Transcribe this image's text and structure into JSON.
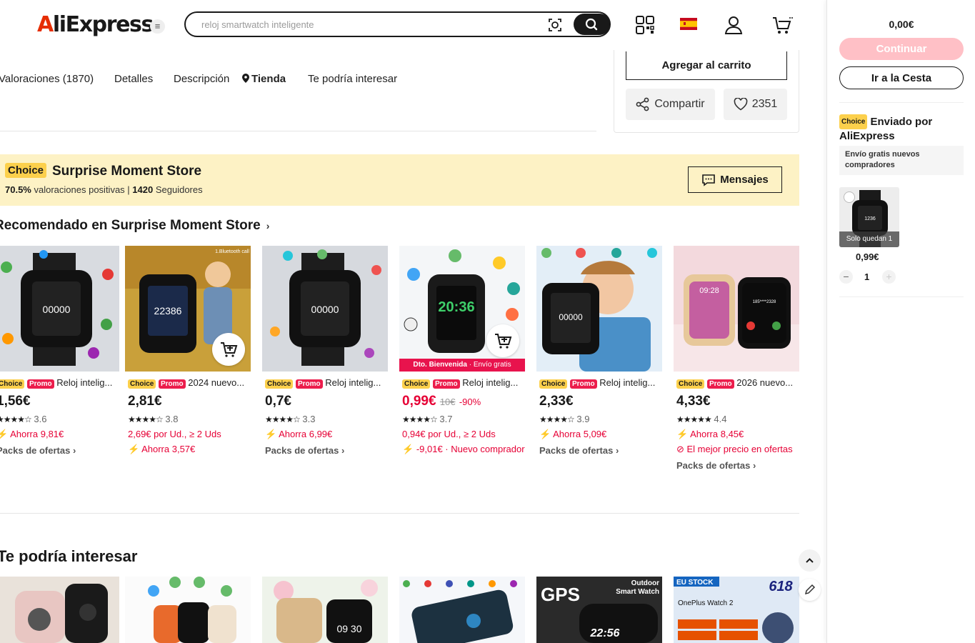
{
  "header": {
    "logo_text": "AliExpress",
    "search_placeholder": "reloj smartwatch inteligente"
  },
  "tabs": [
    {
      "label": "Valoraciones (1870)"
    },
    {
      "label": "Detalles"
    },
    {
      "label": "Descripción"
    },
    {
      "label": "Tienda"
    },
    {
      "label": "Te podría interesar"
    }
  ],
  "buy_box": {
    "add_to_cart": "Agregar al carrito",
    "share": "Compartir",
    "wishlist_count": "2351"
  },
  "store": {
    "choice": "Choice",
    "name": "Surprise Moment Store",
    "positive_rate": "70.5%",
    "positive_label": "valoraciones positivas |",
    "followers": "1420",
    "followers_label": "Seguidores",
    "messages_button": "Mensajes"
  },
  "section1_title": "Recomendado en Surprise Moment Store",
  "section2_title": "Te podría interesar",
  "badges": {
    "choice": "Choice",
    "promo": "Promo"
  },
  "products": [
    {
      "title": "Reloj intelig...",
      "price": "1,56€",
      "rating": "3.6",
      "line1": "Ahorra 9,81€",
      "line2": "Packs de ofertas",
      "line3": ""
    },
    {
      "title": "2024 nuevo...",
      "price": "2,81€",
      "rating": "3.8",
      "line1": "2,69€ por Ud., ≥ 2 Uds",
      "line2": "Ahorra 3,57€",
      "line3": ""
    },
    {
      "title": "Reloj intelig...",
      "price": "0,7€",
      "rating": "3.3",
      "line1": "Ahorra 6,99€",
      "line2": "Packs de ofertas",
      "line3": ""
    },
    {
      "title": "Reloj intelig...",
      "price": "0,99€",
      "old_price": "10€",
      "discount": "-90%",
      "rating": "3.7",
      "line1": "0,94€ por Ud., ≥ 2 Uds",
      "line2": "-9,01€ · Nuevo comprador",
      "line3": "",
      "banner": "Dto. Bienvenida",
      "banner_sub": "Envío gratis"
    },
    {
      "title": "Reloj intelig...",
      "price": "2,33€",
      "rating": "3.9",
      "line1": "Ahorra 5,09€",
      "line2": "Packs de ofertas",
      "line3": ""
    },
    {
      "title": "2026 nuevo...",
      "price": "4,33€",
      "rating": "4.4",
      "line1": "Ahorra 8,45€",
      "line2": "El mejor precio en ofertas",
      "line3": "Packs de ofertas"
    }
  ],
  "side_cart": {
    "total": "0,00€",
    "continue": "Continuar",
    "basket": "Ir a la Cesta",
    "choice": "Choice",
    "shipped_by": "Enviado por AliExpress",
    "free_shipping": "Envío gratis nuevos compradores",
    "remaining": "Solo quedan 1",
    "item_price": "0,99€",
    "qty": "1"
  },
  "colors": {
    "accent_red": "#e60035",
    "choice_yellow": "#fcd04c",
    "banner_bg": "#fdf2c5",
    "continue_pink": "#ffc0c6"
  }
}
